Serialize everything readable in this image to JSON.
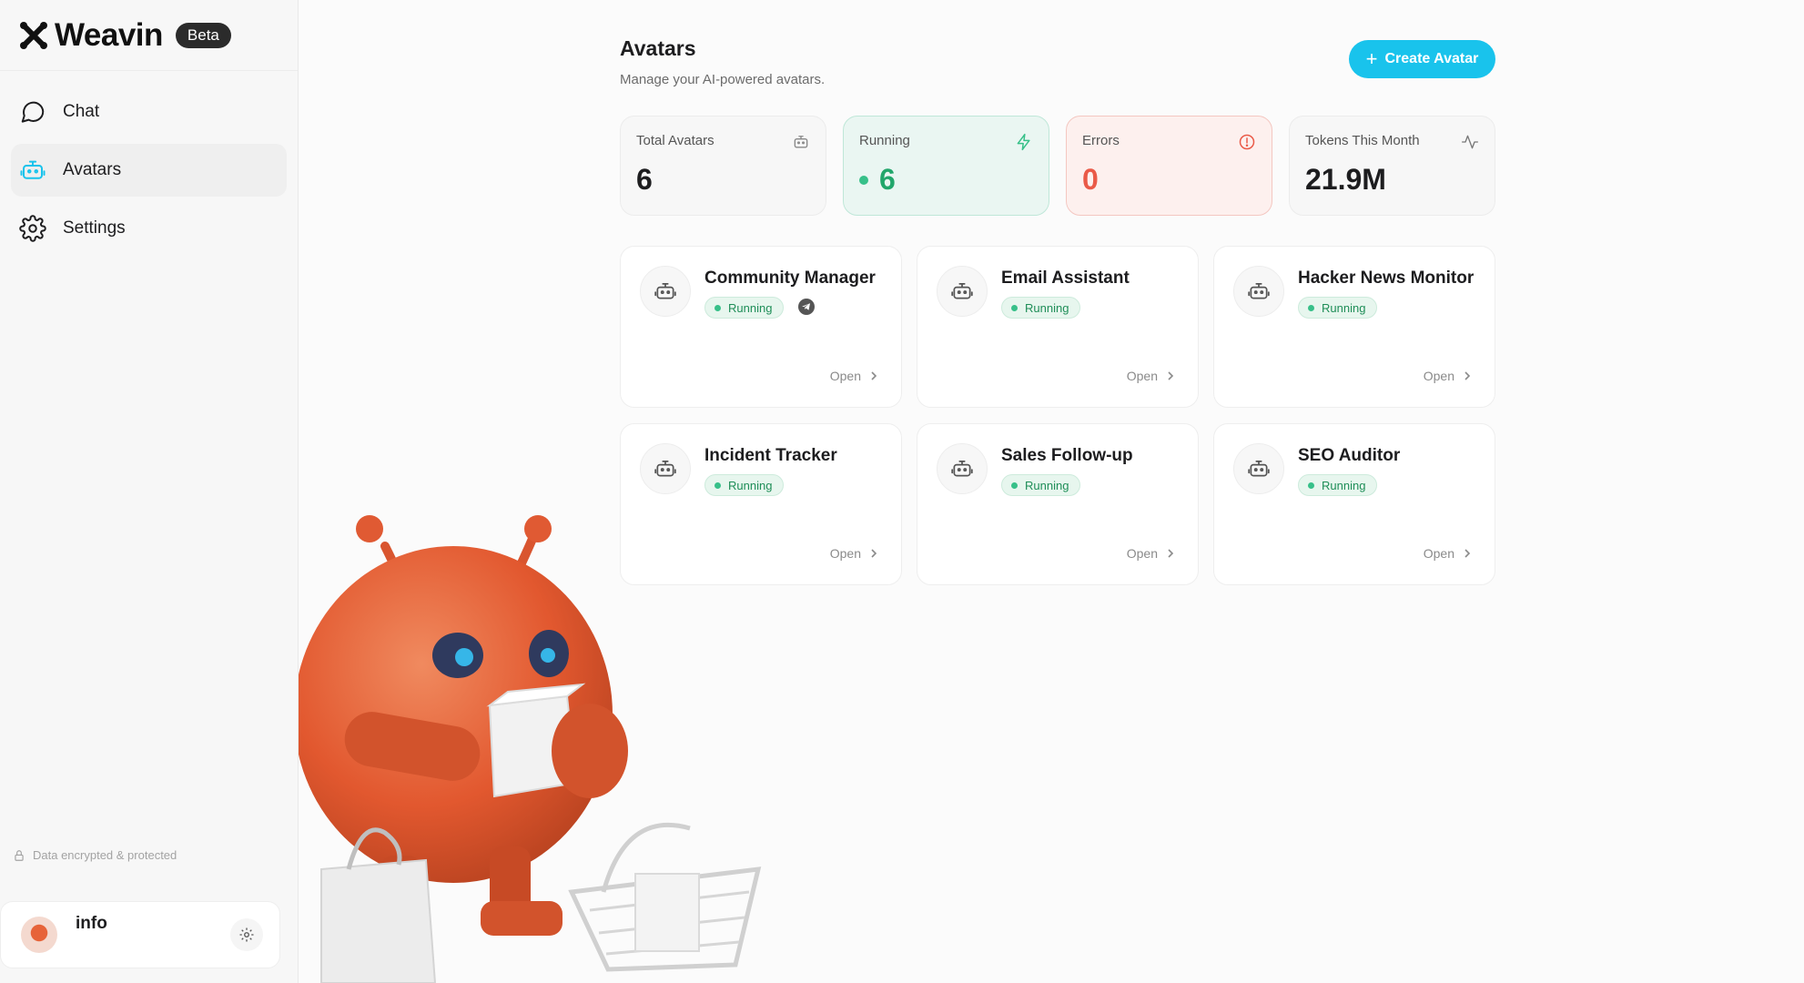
{
  "brand": {
    "name": "Weavin",
    "badge": "Beta"
  },
  "sidebar": {
    "items": [
      {
        "label": "Chat",
        "icon": "chat-bubble-icon",
        "active": false
      },
      {
        "label": "Avatars",
        "icon": "robot-icon",
        "active": true
      },
      {
        "label": "Settings",
        "icon": "gear-icon",
        "active": false
      }
    ],
    "security_note": "Data encrypted & protected",
    "user": {
      "name": "info"
    }
  },
  "header": {
    "title": "Avatars",
    "subtitle": "Manage your AI-powered avatars.",
    "create_label": "Create Avatar"
  },
  "stats": {
    "total": {
      "label": "Total Avatars",
      "value": "6"
    },
    "running": {
      "label": "Running",
      "value": "6"
    },
    "errors": {
      "label": "Errors",
      "value": "0"
    },
    "tokens": {
      "label": "Tokens This Month",
      "value": "21.9M"
    }
  },
  "avatars": [
    {
      "name": "Community Manager",
      "status": "Running",
      "open": "Open",
      "telegram": true
    },
    {
      "name": "Email Assistant",
      "status": "Running",
      "open": "Open",
      "telegram": false
    },
    {
      "name": "Hacker News Monitor",
      "status": "Running",
      "open": "Open",
      "telegram": false
    },
    {
      "name": "Incident Tracker",
      "status": "Running",
      "open": "Open",
      "telegram": false
    },
    {
      "name": "Sales Follow-up",
      "status": "Running",
      "open": "Open",
      "telegram": false
    },
    {
      "name": "SEO Auditor",
      "status": "Running",
      "open": "Open",
      "telegram": false
    }
  ],
  "colors": {
    "accent": "#19c3ec",
    "running": "#22a66b",
    "error": "#ea5a48",
    "mascot": "#e2582f"
  }
}
